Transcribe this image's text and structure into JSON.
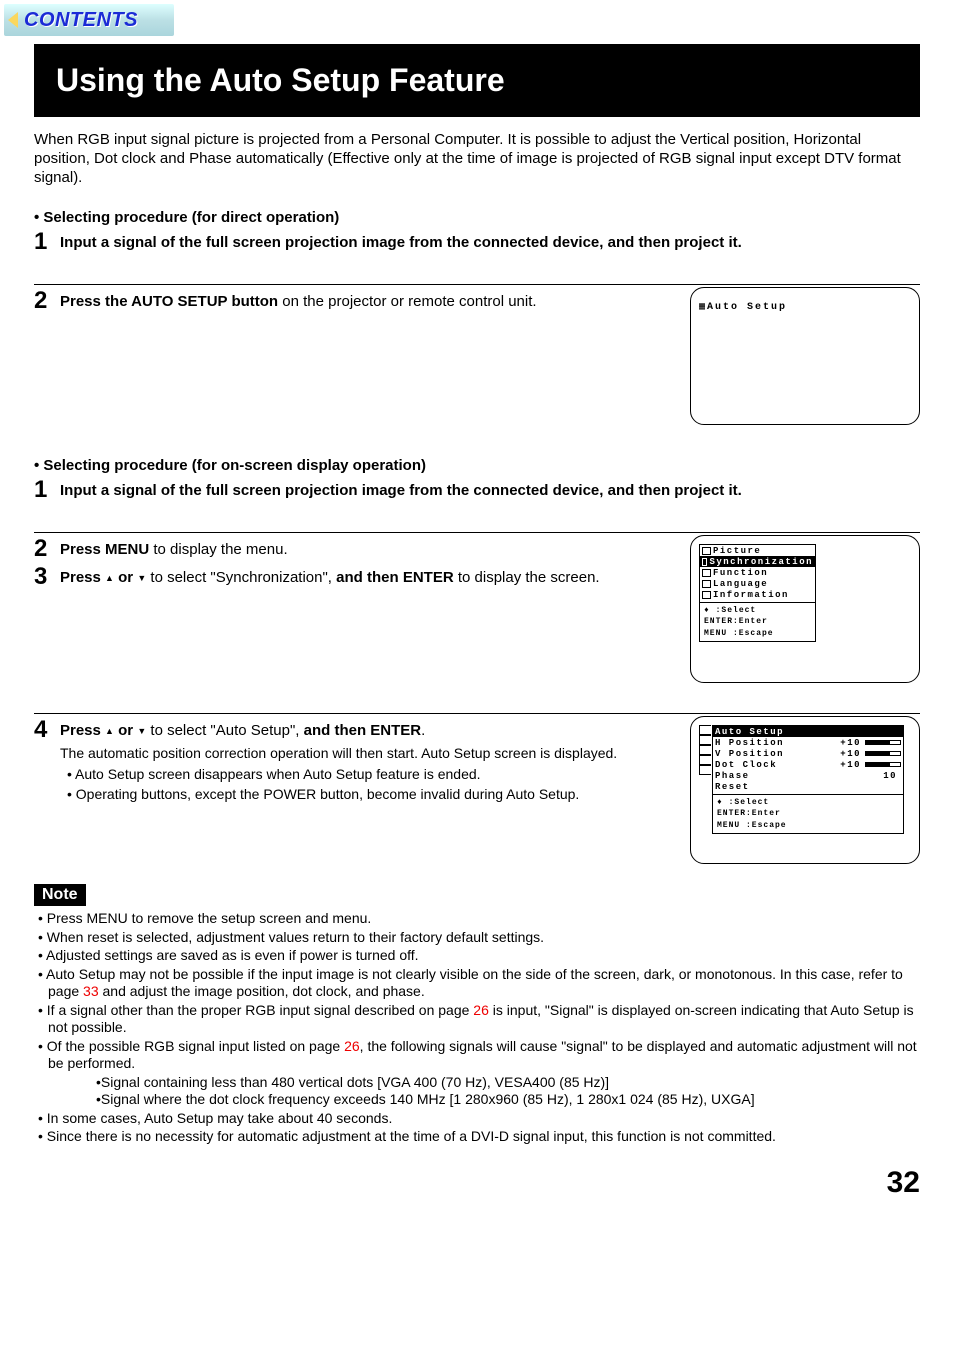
{
  "banner": {
    "label": "CONTENTS"
  },
  "title": "Using the Auto Setup Feature",
  "intro": "When RGB input signal picture is projected from a Personal Computer. It is possible to adjust the Vertical position, Horizontal position, Dot clock and Phase automatically (Effective only at the time of image is projected of RGB signal input except DTV format signal).",
  "secA": {
    "heading": "Selecting procedure (for direct operation)",
    "step1": "Input a signal of the full screen projection image from the connected device, and then project it.",
    "step2_b": "Press the AUTO SETUP button",
    "step2_r": " on the projector or remote control unit."
  },
  "secB": {
    "heading": "Selecting procedure (for on-screen display operation)",
    "step1": "Input a signal of the full screen projection image from the connected device, and then project it.",
    "step2_b": "Press MENU",
    "step2_r": " to display the menu.",
    "step3_b1": "Press ",
    "step3_b2": " or ",
    "step3_r1": " to select \"Synchronization\", ",
    "step3_b3": "and then ENTER",
    "step3_r2": " to display the screen.",
    "step4_b1": "Press ",
    "step4_b2": " or ",
    "step4_r1": " to select \"Auto Setup\", ",
    "step4_b3": "and then ENTER",
    "step4_r2": ".",
    "step4_sub": "The automatic position correction operation will then start. Auto Setup screen is displayed.",
    "step4_s1": "Auto Setup screen disappears when Auto Setup feature is ended.",
    "step4_s2": "Operating buttons, except the POWER button, become invalid during Auto Setup."
  },
  "osd1": {
    "title": "Auto Setup"
  },
  "osd2": {
    "items": [
      "Picture",
      "Synchronization",
      "Function",
      "Language",
      "Information"
    ],
    "hint1": "    :Select",
    "hint2": "ENTER:Enter",
    "hint3": "MENU :Escape"
  },
  "osd3": {
    "title": "Auto Setup",
    "rows": [
      {
        "label": "H Position",
        "val": "+10",
        "bar": true
      },
      {
        "label": "V Position",
        "val": "+10",
        "bar": true
      },
      {
        "label": "Dot Clock",
        "val": "+10",
        "bar": true
      },
      {
        "label": "Phase",
        "val": "10",
        "bar": false
      },
      {
        "label": "Reset",
        "val": "",
        "bar": false
      }
    ],
    "hint1": "    :Select",
    "hint2": "ENTER:Enter",
    "hint3": "MENU :Escape"
  },
  "note_label": "Note",
  "notes": {
    "n1": "Press MENU to remove the setup screen and menu.",
    "n2": "When reset is selected, adjustment values return to their factory default settings.",
    "n3": "Adjusted settings are saved as is even if power is turned off.",
    "n4a": "Auto Setup may not be possible if the input image is not clearly visible on the side of the screen, dark, or monotonous. In this case, refer to page ",
    "n4p": "33",
    "n4b": " and adjust the image position, dot clock, and phase.",
    "n5a": "If a signal other than the proper RGB input signal described on page ",
    "n5p": "26",
    "n5b": " is input, \"Signal\" is displayed on-screen indicating that Auto Setup is not possible.",
    "n6a": "Of the possible RGB signal input listed on page ",
    "n6p": "26",
    "n6b": ", the following signals will cause \"signal\" to be displayed and automatic adjustment will not be performed.",
    "n6s1": "Signal containing less than 480 vertical dots [VGA 400 (70 Hz), VESA400 (85 Hz)]",
    "n6s2": "Signal where the dot clock frequency exceeds 140 MHz [1 280x960 (85 Hz), 1 280x1 024 (85 Hz), UXGA]",
    "n7": "In some cases, Auto Setup may take about 40 seconds.",
    "n8": "Since there is no necessity for automatic adjustment at the time of a DVI-D signal input, this function is not committed."
  },
  "page_number": "32"
}
